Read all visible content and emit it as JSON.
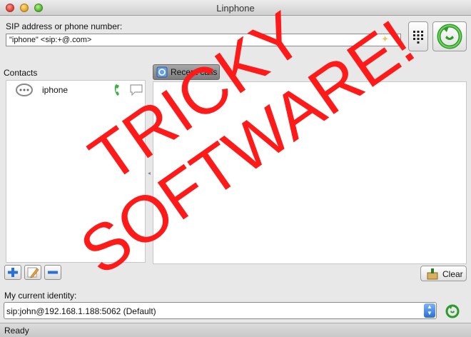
{
  "window": {
    "title": "Linphone"
  },
  "sip": {
    "label": "SIP address or phone number:",
    "value": "\"iphone\" <sip:+@.com>"
  },
  "contacts": {
    "label": "Contacts",
    "items": [
      {
        "name": "iphone"
      }
    ]
  },
  "tabs": {
    "recent_calls": "Recent calls"
  },
  "buttons": {
    "clear": "Clear"
  },
  "identity": {
    "label": "My current identity:",
    "value": "sip:john@192.168.1.188:5062 (Default)"
  },
  "status": {
    "text": "Ready"
  },
  "overlay": {
    "line1": "TRICKY",
    "line2": "SOFTWARE!",
    "color": "#ff1a1a"
  },
  "colors": {
    "call_green": "#3cb043",
    "accent_blue": "#2a6fd4"
  }
}
